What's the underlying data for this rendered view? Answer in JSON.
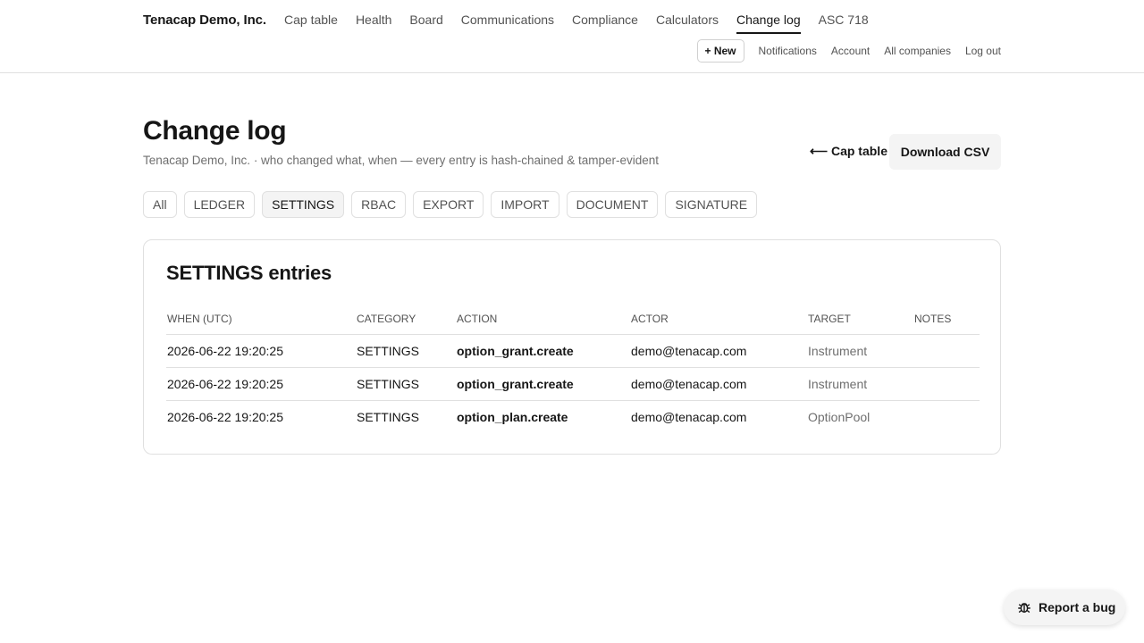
{
  "header": {
    "brand": "Tenacap Demo, Inc.",
    "nav": [
      {
        "label": "Cap table",
        "active": false
      },
      {
        "label": "Health",
        "active": false
      },
      {
        "label": "Board",
        "active": false
      },
      {
        "label": "Communications",
        "active": false
      },
      {
        "label": "Compliance",
        "active": false
      },
      {
        "label": "Calculators",
        "active": false
      },
      {
        "label": "Change log",
        "active": true
      },
      {
        "label": "ASC 718",
        "active": false
      }
    ],
    "new_button": "+ New",
    "subnav": [
      "Notifications",
      "Account",
      "All companies",
      "Log out"
    ]
  },
  "page": {
    "title": "Change log",
    "subtitle": "Tenacap Demo, Inc. · who changed what, when — every entry is hash-chained & tamper-evident",
    "back_link": "⟵ Cap table",
    "download_button": "Download CSV"
  },
  "filters": {
    "chips": [
      "All",
      "LEDGER",
      "SETTINGS",
      "RBAC",
      "EXPORT",
      "IMPORT",
      "DOCUMENT",
      "SIGNATURE"
    ],
    "active": "SETTINGS"
  },
  "card": {
    "title": "SETTINGS entries",
    "columns": [
      "WHEN (UTC)",
      "CATEGORY",
      "ACTION",
      "ACTOR",
      "TARGET",
      "NOTES"
    ],
    "rows": [
      {
        "when": "2026-06-22 19:20:25",
        "category": "SETTINGS",
        "action": "option_grant.create",
        "actor": "demo@tenacap.com",
        "target": "Instrument",
        "notes": ""
      },
      {
        "when": "2026-06-22 19:20:25",
        "category": "SETTINGS",
        "action": "option_grant.create",
        "actor": "demo@tenacap.com",
        "target": "Instrument",
        "notes": ""
      },
      {
        "when": "2026-06-22 19:20:25",
        "category": "SETTINGS",
        "action": "option_plan.create",
        "actor": "demo@tenacap.com",
        "target": "OptionPool",
        "notes": ""
      }
    ]
  },
  "bug_button": {
    "label": "Report a bug",
    "icon": "bug-icon"
  }
}
